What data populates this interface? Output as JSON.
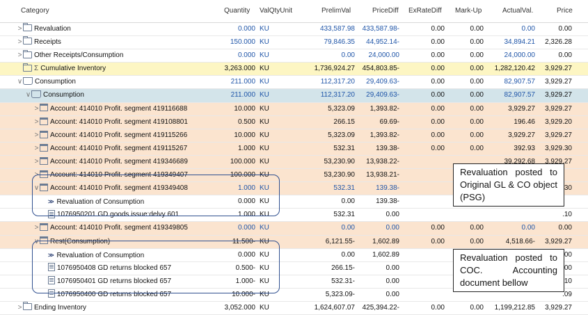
{
  "columns": {
    "category": "Category",
    "quantity": "Quantity",
    "valqtyunit": "ValQtyUnit",
    "prelimval": "PrelimVal",
    "pricediff": "PriceDiff",
    "exratediff": "ExRateDiff",
    "markup": "Mark-Up",
    "actualval": "ActualVal.",
    "price": "Price"
  },
  "rows": [
    {
      "label": "Revaluation",
      "quantity": "0.000",
      "unit": "KU",
      "prelim": "433,587.98",
      "pdiff": "433,587.98-",
      "ex": "0.00",
      "mark": "0.00",
      "act": "0.00",
      "price": "0.00"
    },
    {
      "label": "Receipts",
      "quantity": "150.000",
      "unit": "KU",
      "prelim": "79,846.35",
      "pdiff": "44,952.14-",
      "ex": "0.00",
      "mark": "0.00",
      "act": "34,894.21",
      "price": "2,326.28"
    },
    {
      "label": "Other Receipts/Consumption",
      "quantity": "0.000",
      "unit": "KU",
      "prelim": "0.00",
      "pdiff": "24,000.00",
      "ex": "0.00",
      "mark": "0.00",
      "act": "24,000.00",
      "price": "0.00"
    },
    {
      "label": "Cumulative Inventory",
      "quantity": "3,263.000",
      "unit": "KU",
      "prelim": "1,736,924.27",
      "pdiff": "454,803.85-",
      "ex": "0.00",
      "mark": "0.00",
      "act": "1,282,120.42",
      "price": "3,929.27"
    },
    {
      "label": "Consumption",
      "quantity": "211.000",
      "unit": "KU",
      "prelim": "112,317.20",
      "pdiff": "29,409.63-",
      "ex": "0.00",
      "mark": "0.00",
      "act": "82,907.57",
      "price": "3,929.27"
    },
    {
      "label": "Consumption",
      "quantity": "211.000",
      "unit": "KU",
      "prelim": "112,317.20",
      "pdiff": "29,409.63-",
      "ex": "0.00",
      "mark": "0.00",
      "act": "82,907.57",
      "price": "3,929.27"
    },
    {
      "label": "Account: 414010 Profit. segment 419116688",
      "quantity": "10.000",
      "unit": "KU",
      "prelim": "5,323.09",
      "pdiff": "1,393.82-",
      "ex": "0.00",
      "mark": "0.00",
      "act": "3,929.27",
      "price": "3,929.27"
    },
    {
      "label": "Account: 414010 Profit. segment 419108801",
      "quantity": "0.500",
      "unit": "KU",
      "prelim": "266.15",
      "pdiff": "69.69-",
      "ex": "0.00",
      "mark": "0.00",
      "act": "196.46",
      "price": "3,929.20"
    },
    {
      "label": "Account: 414010 Profit. segment 419115266",
      "quantity": "10.000",
      "unit": "KU",
      "prelim": "5,323.09",
      "pdiff": "1,393.82-",
      "ex": "0.00",
      "mark": "0.00",
      "act": "3,929.27",
      "price": "3,929.27"
    },
    {
      "label": "Account: 414010 Profit. segment 419115267",
      "quantity": "1.000",
      "unit": "KU",
      "prelim": "532.31",
      "pdiff": "139.38-",
      "ex": "0.00",
      "mark": "0.00",
      "act": "392.93",
      "price": "3,929.30"
    },
    {
      "label": "Account: 414010 Profit. segment 419346689",
      "quantity": "100.000",
      "unit": "KU",
      "prelim": "53,230.90",
      "pdiff": "13,938.22-",
      "ex": "",
      "mark": "",
      "act": "39,292.68",
      "price": "3,929.27"
    },
    {
      "label": "Account: 414010 Profit. segment 419349407",
      "quantity": "100.000",
      "unit": "KU",
      "prelim": "53,230.90",
      "pdiff": "13,938.21-",
      "ex": "",
      "mark": "",
      "act": "",
      "price": ""
    },
    {
      "label": "Account: 414010 Profit. segment 419349408",
      "quantity": "1.000",
      "unit": "KU",
      "prelim": "532.31",
      "pdiff": "139.38-",
      "ex": "",
      "mark": "",
      "act": "",
      "price": ".30"
    },
    {
      "label": "Revaluation of Consumption",
      "quantity": "0.000",
      "unit": "KU",
      "prelim": "0.00",
      "pdiff": "139.38-",
      "ex": "",
      "mark": "",
      "act": "",
      "price": ""
    },
    {
      "label": "1076950201 GD goods issue:delvy 601",
      "quantity": "1.000",
      "unit": "KU",
      "prelim": "532.31",
      "pdiff": "0.00",
      "ex": "",
      "mark": "",
      "act": "",
      "price": ".10"
    },
    {
      "label": "Account: 414010 Profit. segment 419349805",
      "quantity": "0.000",
      "unit": "KU",
      "prelim": "0.00",
      "pdiff": "0.00",
      "ex": "0.00",
      "mark": "0.00",
      "act": "0.00",
      "price": "0.00"
    },
    {
      "label": "Rest(Consumption)",
      "quantity": "11.500-",
      "unit": "KU",
      "prelim": "6,121.55-",
      "pdiff": "1,602.89",
      "ex": "0.00",
      "mark": "0.00",
      "act": "4,518.66-",
      "price": "3,929.27"
    },
    {
      "label": "Revaluation of Consumption",
      "quantity": "0.000",
      "unit": "KU",
      "prelim": "0.00",
      "pdiff": "1,602.89",
      "ex": "",
      "mark": "",
      "act": "",
      "price": ".00"
    },
    {
      "label": "1076950408 GD returns blocked 657",
      "quantity": "0.500-",
      "unit": "KU",
      "prelim": "266.15-",
      "pdiff": "0.00",
      "ex": "",
      "mark": "",
      "act": "",
      "price": ".00"
    },
    {
      "label": "1076950401 GD returns blocked 657",
      "quantity": "1.000-",
      "unit": "KU",
      "prelim": "532.31-",
      "pdiff": "0.00",
      "ex": "",
      "mark": "",
      "act": "",
      "price": ".10"
    },
    {
      "label": "1076950400 GD returns blocked 657",
      "quantity": "10.000-",
      "unit": "KU",
      "prelim": "5,323.09-",
      "pdiff": "0.00",
      "ex": "",
      "mark": "",
      "act": "",
      "price": ".09"
    },
    {
      "label": "Ending Inventory",
      "quantity": "3,052.000",
      "unit": "KU",
      "prelim": "1,624,607.07",
      "pdiff": "425,394.22-",
      "ex": "0.00",
      "mark": "0.00",
      "act": "1,199,212.85",
      "price": "3,929.27"
    }
  ],
  "notes": [
    "Revaluation posted to Original GL & CO object (PSG)",
    "Revaluation posted to COC. Accounting document bellow"
  ],
  "colors": {
    "yellow": "#fdf6c3",
    "teal": "#d3e4ea",
    "peach": "#fbe4cf",
    "blue": "#1f55a8",
    "box": "#2f4f8f"
  }
}
